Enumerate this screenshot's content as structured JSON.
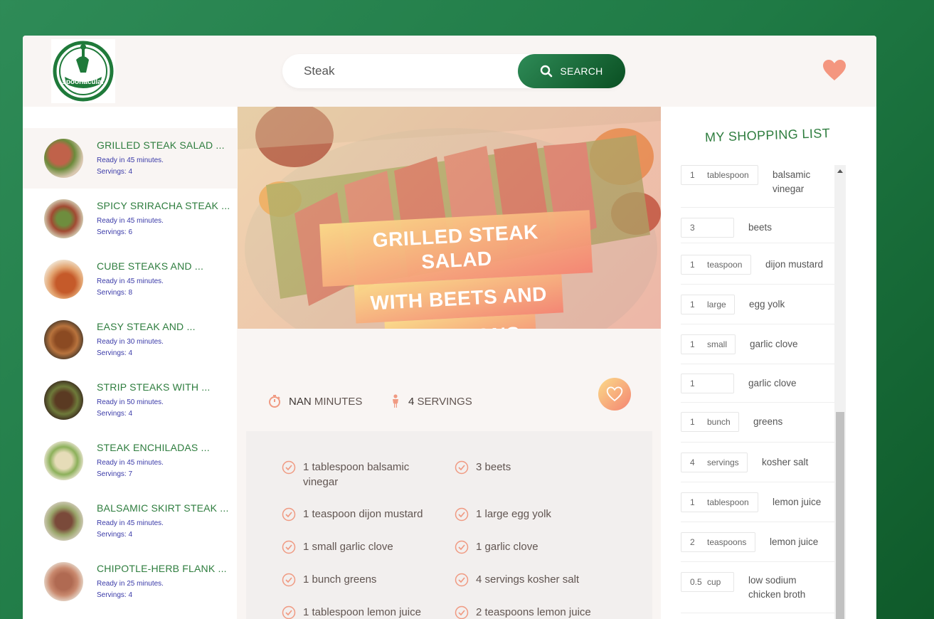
{
  "header": {
    "logo_text": "spoonacular",
    "search_value": "Steak",
    "search_label": "SEARCH"
  },
  "results": [
    {
      "title": "GRILLED STEAK SALAD ...",
      "ready": "Ready in 45 minutes.",
      "servings": "Servings: 4",
      "active": true
    },
    {
      "title": "SPICY SRIRACHA STEAK ...",
      "ready": "Ready in 45 minutes.",
      "servings": "Servings: 6"
    },
    {
      "title": "CUBE STEAKS AND ...",
      "ready": "Ready in 45 minutes.",
      "servings": "Servings: 8"
    },
    {
      "title": "EASY STEAK AND ...",
      "ready": "Ready in 30 minutes.",
      "servings": "Servings: 4"
    },
    {
      "title": "STRIP STEAKS WITH ...",
      "ready": "Ready in 50 minutes.",
      "servings": "Servings: 4"
    },
    {
      "title": "STEAK ENCHILADAS ...",
      "ready": "Ready in 45 minutes.",
      "servings": "Servings: 7"
    },
    {
      "title": "BALSAMIC SKIRT STEAK ...",
      "ready": "Ready in 45 minutes.",
      "servings": "Servings: 4"
    },
    {
      "title": "CHIPOTLE-HERB FLANK ...",
      "ready": "Ready in 25 minutes.",
      "servings": "Servings: 4"
    }
  ],
  "recipe": {
    "title_lines": [
      "GRILLED STEAK SALAD",
      "WITH BEETS AND",
      "SCALLIONS"
    ],
    "time_value": "NAN",
    "time_unit": "MINUTES",
    "servings_value": "4",
    "servings_unit": "SERVINGS",
    "ingredients": [
      "1 tablespoon balsamic vinegar",
      "3 beets",
      "1 teaspoon dijon mustard",
      "1 large egg yolk",
      "1 small garlic clove",
      "1 garlic clove",
      "1 bunch greens",
      "4 servings kosher salt",
      "1 tablespoon lemon juice",
      "2 teaspoons lemon juice"
    ]
  },
  "shopping": {
    "title": "MY SHOPPING LIST",
    "items": [
      {
        "qty": "1",
        "unit": "tablespoon",
        "name": "balsamic vinegar"
      },
      {
        "qty": "3",
        "unit": "",
        "name": "beets"
      },
      {
        "qty": "1",
        "unit": "teaspoon",
        "name": "dijon mustard"
      },
      {
        "qty": "1",
        "unit": "large",
        "name": "egg yolk"
      },
      {
        "qty": "1",
        "unit": "small",
        "name": "garlic clove"
      },
      {
        "qty": "1",
        "unit": "",
        "name": "garlic clove"
      },
      {
        "qty": "1",
        "unit": "bunch",
        "name": "greens"
      },
      {
        "qty": "4",
        "unit": "servings",
        "name": "kosher salt"
      },
      {
        "qty": "1",
        "unit": "tablespoon",
        "name": "lemon juice"
      },
      {
        "qty": "2",
        "unit": "teaspoons",
        "name": "lemon juice"
      },
      {
        "qty": "0.5",
        "unit": "cup",
        "name": "low sodium chicken broth"
      }
    ]
  },
  "colors": {
    "brand_green": "#2e7d3e",
    "accent_gradient_start": "#fbdb89",
    "accent_gradient_end": "#f48472",
    "link_blue": "#3a3aa8"
  }
}
